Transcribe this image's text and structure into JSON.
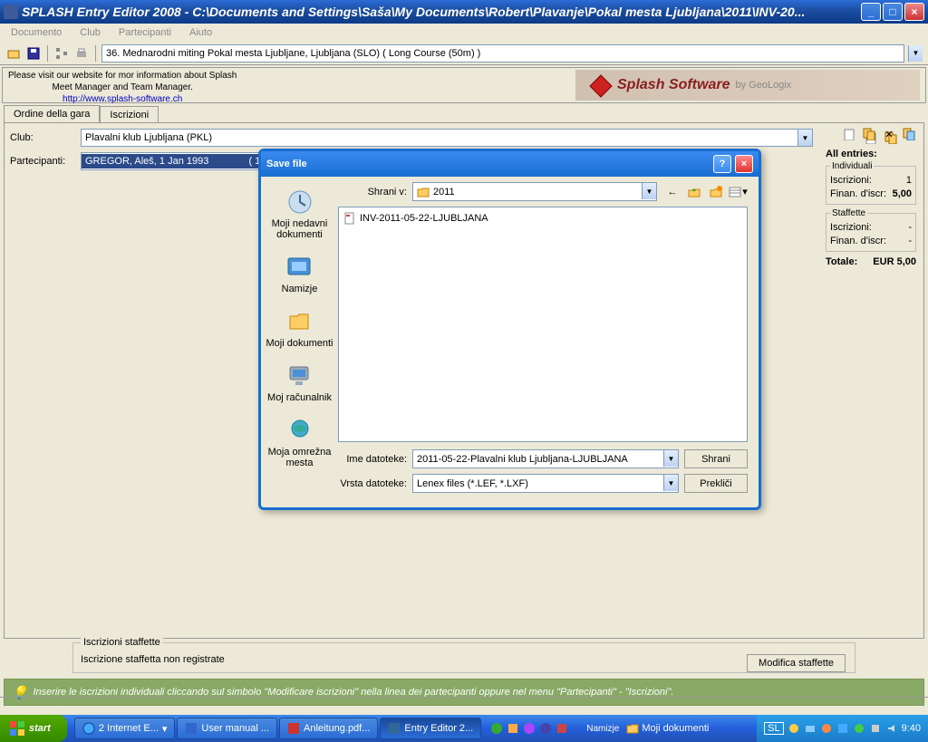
{
  "window": {
    "title": "SPLASH Entry Editor 2008 - C:\\Documents and Settings\\Saša\\My Documents\\Robert\\Plavanje\\Pokal mesta Ljubljana\\2011\\INV-20..."
  },
  "menu": {
    "documento": "Documento",
    "club": "Club",
    "partecipanti": "Partecipanti",
    "aiuto": "Aiuto"
  },
  "toolbar": {
    "meet": "36. Mednarodni  miting Pokal mesta Ljubljane,  Ljubljana  (SLO)    ( Long Course (50m) )"
  },
  "info": {
    "line1": "Please visit our website for mor information about Splash",
    "line2": "Meet Manager and Team Manager.",
    "link": "http://www.splash-software.ch",
    "logo": "Splash Software",
    "by": "by GeoLogix"
  },
  "tabs": {
    "ordine": "Ordine della gara",
    "iscrizioni": "Iscrizioni"
  },
  "labels": {
    "club": "Club:",
    "partecipanti": "Partecipanti:"
  },
  "club": {
    "value": "Plavalni klub Ljubljana (PKL)"
  },
  "participant": {
    "name": "GREGOR, Aleš, 1 Jan 1993",
    "count": "( 1 )"
  },
  "dialog": {
    "title": "Save file",
    "shrani_v": "Shrani v:",
    "folder": "2011",
    "file_in_list": "INV-2011-05-22-LJUBLJANA",
    "ime": "Ime datoteke:",
    "ime_val": "2011-05-22-Plavalni klub Ljubljana-LJUBLJANA",
    "vrsta": "Vrsta datoteke:",
    "vrsta_val": "Lenex files (*.LEF, *.LXF)",
    "save": "Shrani",
    "cancel": "Prekliči",
    "places": {
      "recent": "Moji nedavni dokumenti",
      "desktop": "Namizje",
      "docs": "Moji dokumenti",
      "computer": "Moj računalnik",
      "network": "Moja omrežna mesta"
    }
  },
  "summary": {
    "title": "All entries:",
    "individuali": "Individuali",
    "iscrizioni": "Iscrizioni:",
    "finan": "Finan. d'iscr:",
    "staffette": "Staffette",
    "isc_val": "1",
    "fin_val": "5,00",
    "isc_s": "-",
    "fin_s": "-",
    "totale": "Totale:",
    "totale_val": "EUR 5,00"
  },
  "staffbox": {
    "legend": "Iscrizioni staffette",
    "msg": "Iscrizione staffetta non registrate",
    "btn": "Modifica staffette"
  },
  "hint": "Inserire le iscrizioni individuali cliccando sul simbolo \"Modificare iscrizioni\" nella linea dei partecipanti oppure nel menu \"Partecipanti\" - \"Iscrizioni\".",
  "taskbar": {
    "start": "start",
    "ie": "2 Internet E...",
    "word": "User  manual ...",
    "pdf": "Anleitung.pdf...",
    "entry": "Entry Editor 2...",
    "namizje": "Namizje",
    "moji": "Moji dokumenti",
    "lang": "SL",
    "time": "9:40"
  }
}
